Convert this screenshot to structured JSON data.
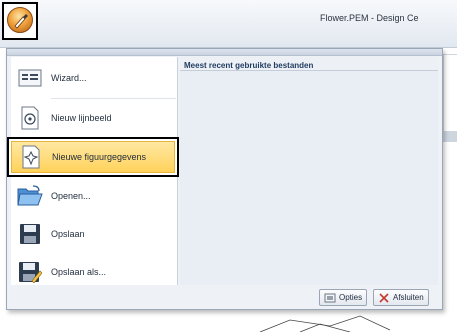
{
  "window": {
    "title": "Flower.PEM - Design Ce"
  },
  "app_button": {
    "icon": "app-menu-icon"
  },
  "menu": {
    "items": [
      {
        "label": "Wizard...",
        "icon": "wizard-icon"
      },
      {
        "label": "Nieuw lijnbeeld",
        "icon": "new-line-image-icon"
      },
      {
        "label": "Nieuwe figuurgegevens",
        "icon": "new-figure-data-icon"
      },
      {
        "label": "Openen...",
        "icon": "open-folder-icon"
      },
      {
        "label": "Opslaan",
        "icon": "save-icon"
      },
      {
        "label": "Opslaan als...",
        "icon": "save-as-icon"
      }
    ],
    "recent_header": "Meest recent gebruikte bestanden",
    "footer": {
      "options_label": "Opties",
      "exit_label": "Afsluiten"
    }
  },
  "colors": {
    "highlight": "#ffd25a",
    "menu_bg": "#eef1f5",
    "recent_bg": "#e9eef4"
  }
}
